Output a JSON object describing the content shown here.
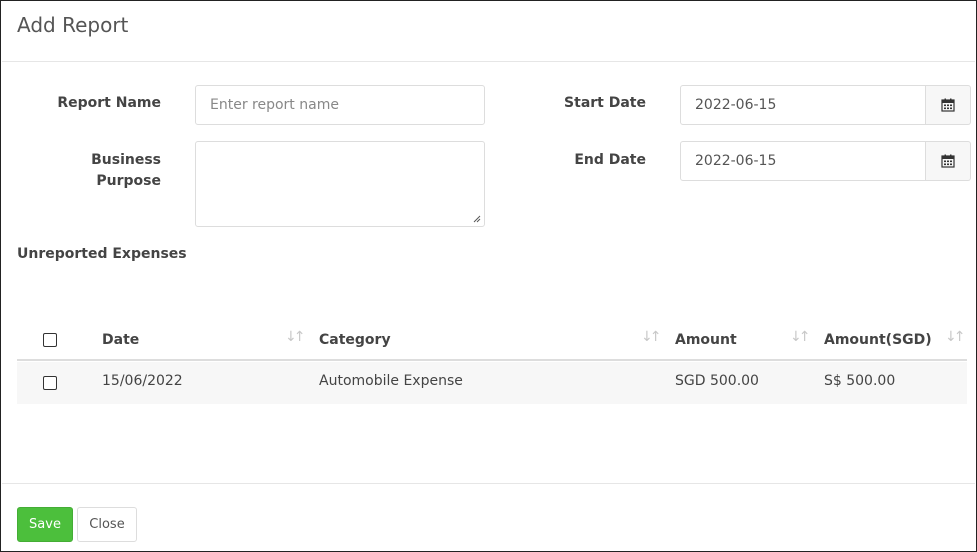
{
  "dialog": {
    "title": "Add Report"
  },
  "form": {
    "report_name_label": "Report Name",
    "report_name_placeholder": "Enter report name",
    "business_purpose_label_line1": "Business",
    "business_purpose_label_line2": "Purpose",
    "start_date_label": "Start Date",
    "start_date_value": "2022-06-15",
    "end_date_label": "End Date",
    "end_date_value": "2022-06-15",
    "calendar_icon": "calendar-icon"
  },
  "expenses": {
    "section_title": "Unreported Expenses",
    "columns": [
      "Date",
      "Category",
      "Amount",
      "Amount(SGD)"
    ],
    "rows": [
      {
        "date": "15/06/2022",
        "category": "Automobile Expense",
        "amount": "SGD 500.00",
        "amount_sgd": "S$ 500.00",
        "checked": false
      }
    ]
  },
  "footer": {
    "save_label": "Save",
    "close_label": "Close"
  },
  "colors": {
    "save_button": "#4cbf3c",
    "highlight": "#f2f200"
  }
}
